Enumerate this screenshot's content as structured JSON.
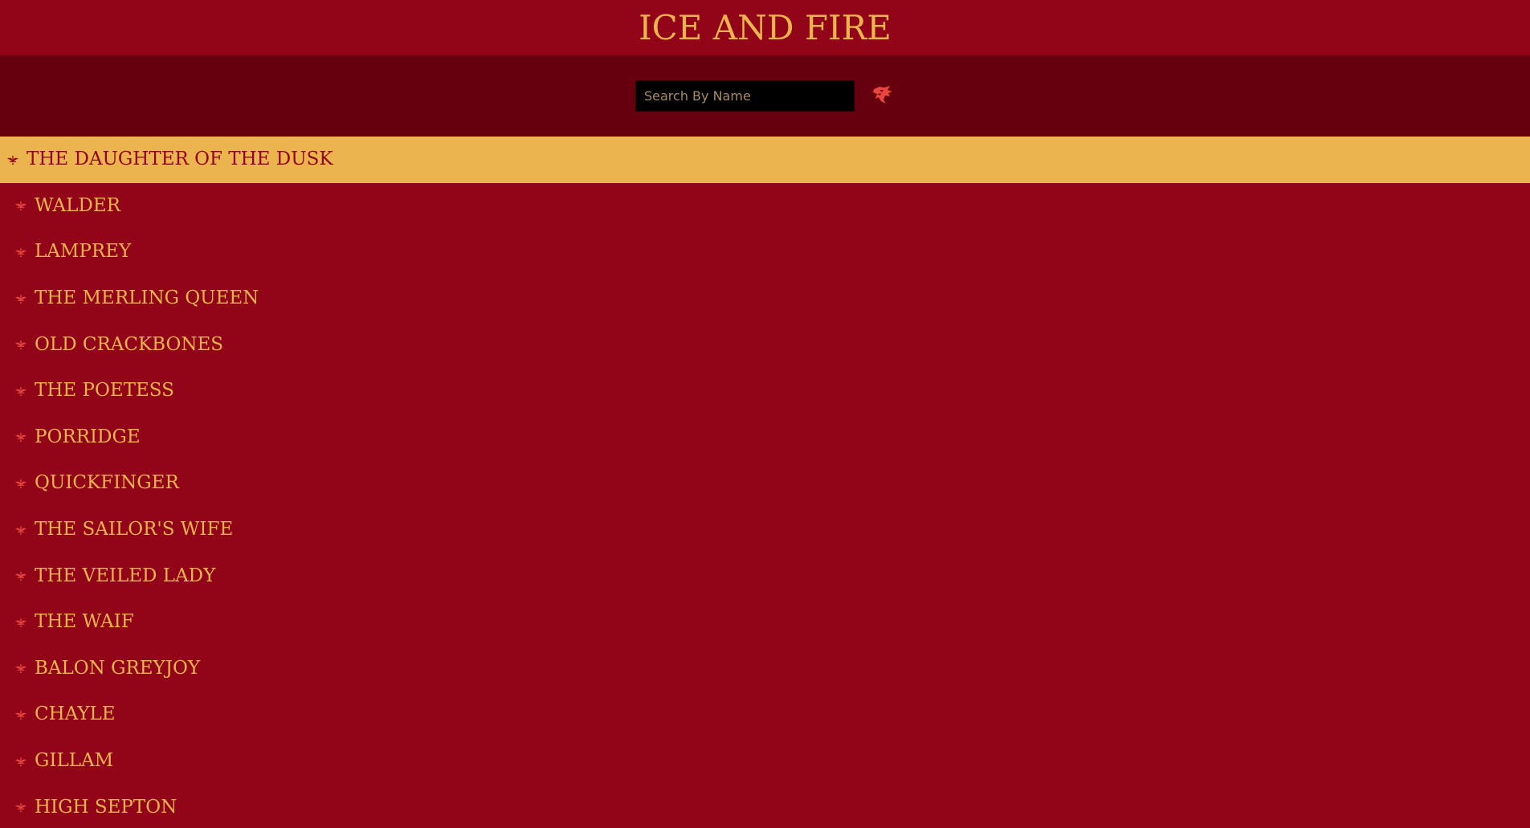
{
  "header": {
    "title": "ICE AND FIRE"
  },
  "search": {
    "placeholder": "Search By Name",
    "value": "",
    "button_icon": "wolf-icon"
  },
  "colors": {
    "background": "#920417",
    "search_bar": "#66000f",
    "accent_gold": "#ecb44e",
    "icon_red": "#e8473f"
  },
  "characters": [
    {
      "name": "THE DAUGHTER OF THE DUSK",
      "active": true
    },
    {
      "name": "WALDER"
    },
    {
      "name": "LAMPREY"
    },
    {
      "name": "THE MERLING QUEEN"
    },
    {
      "name": "OLD CRACKBONES"
    },
    {
      "name": "THE POETESS"
    },
    {
      "name": "PORRIDGE"
    },
    {
      "name": "QUICKFINGER"
    },
    {
      "name": "THE SAILOR'S WIFE"
    },
    {
      "name": "THE VEILED LADY"
    },
    {
      "name": "THE WAIF"
    },
    {
      "name": "BALON GREYJOY"
    },
    {
      "name": "CHAYLE"
    },
    {
      "name": "GILLAM"
    },
    {
      "name": "HIGH SEPTON"
    }
  ]
}
